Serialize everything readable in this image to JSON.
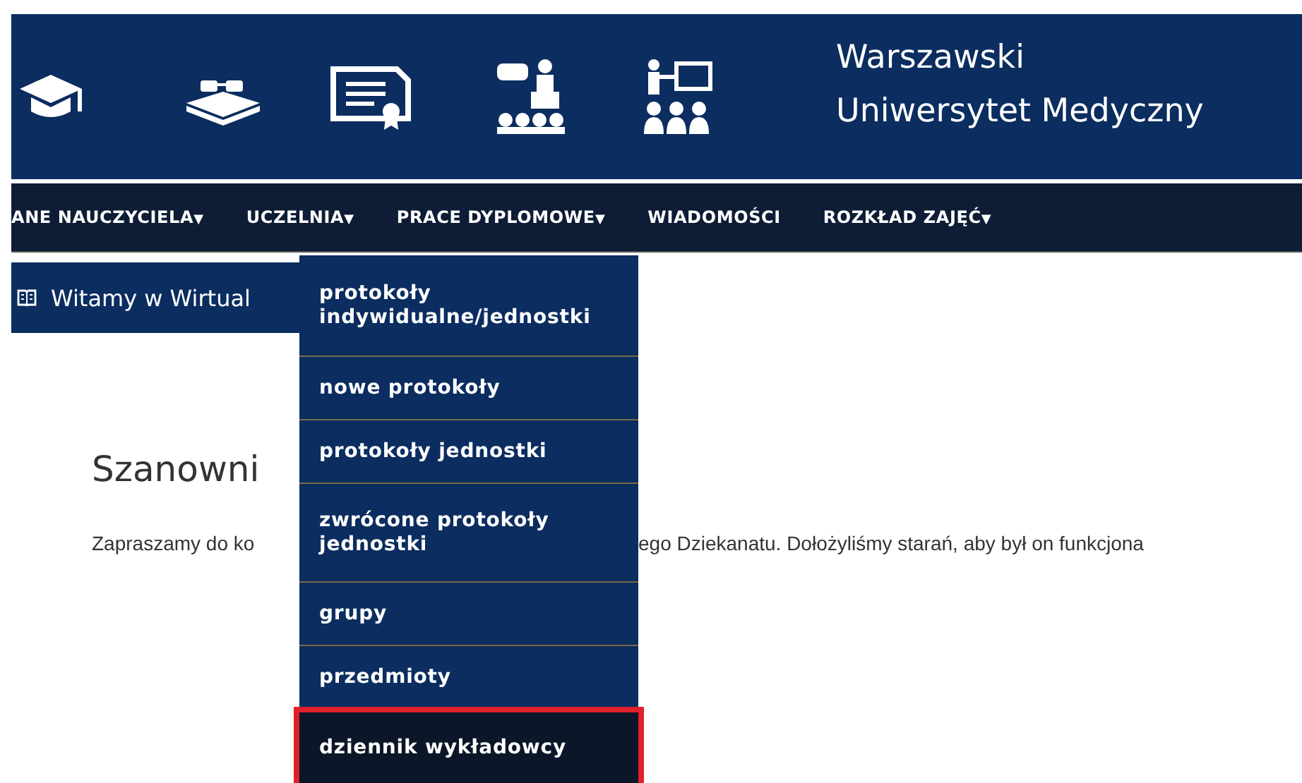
{
  "header": {
    "title_lines": [
      "Warszawski",
      "Uniwersytet Medyczny"
    ],
    "icons": [
      {
        "kind": "cap"
      },
      {
        "kind": "book"
      },
      {
        "kind": "certificate"
      },
      {
        "kind": "lecture"
      },
      {
        "kind": "teacher"
      }
    ]
  },
  "nav": {
    "items": [
      {
        "label": "ANE NAUCZYCIELA",
        "caret": "▼"
      },
      {
        "label": "UCZELNIA",
        "caret": "▼"
      },
      {
        "label": "PRACE DYPLOMOWE",
        "caret": "▼"
      },
      {
        "label": "WIADOMOŚCI"
      },
      {
        "label": "ROZKŁAD ZAJĘĆ",
        "caret": "▼"
      }
    ]
  },
  "dropdown": {
    "items": [
      {
        "label": "protokoły indywidualne/jednostki",
        "selected": false
      },
      {
        "label": "nowe protokoły",
        "selected": false
      },
      {
        "label": "protokoły jednostki",
        "selected": false
      },
      {
        "label": "zwrócone protokoły jednostki",
        "selected": false
      },
      {
        "label": "grupy",
        "selected": false
      },
      {
        "label": "przedmioty",
        "selected": false
      },
      {
        "label": "dziennik wykładowcy",
        "selected": true
      }
    ]
  },
  "welcome_bar": {
    "text": "Witamy w Wirtual"
  },
  "content": {
    "heading": "Szanowni",
    "paragraph_parts": [
      "Zapraszamy do ko",
      "ego Dziekanatu. Dołożyliśmy starań, aby był on funkcjona"
    ]
  }
}
